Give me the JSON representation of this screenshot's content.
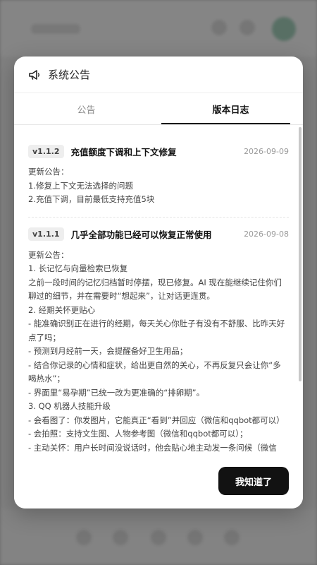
{
  "modal": {
    "title": "系统公告",
    "icon": "megaphone-icon"
  },
  "tabs": [
    {
      "label": "公告",
      "active": false
    },
    {
      "label": "版本日志",
      "active": true
    }
  ],
  "entries": [
    {
      "version": "v1.1.2",
      "title": "充值额度下调和上下文修复",
      "date": "2026-09-09",
      "lines": [
        "更新公告：",
        "1.修复上下文无法选择的问题",
        "2.充值下调，目前最低支持充值5块"
      ]
    },
    {
      "version": "v1.1.1",
      "title": "几乎全部功能已经可以恢复正常使用",
      "date": "2026-09-08",
      "lines": [
        "更新公告：",
        "1. 长记忆与向量检索已恢复",
        "之前一段时间的记忆归档暂时停摆，现已修复。AI 现在能继续记住你们聊过的细节，并在需要时“想起来”，让对话更连贯。",
        "2. 经期关怀更贴心",
        "- 能准确识别正在进行的经期，每天关心你肚子有没有不舒服、比昨天好点了吗；",
        "- 预测到月经前一天，会提醒备好卫生用品；",
        "- 结合你记录的心情和症状，给出更自然的关心，不再反复只会让你“多喝热水”；",
        "- 界面里“易孕期”已统一改为更准确的“排卵期”。",
        "3. QQ 机器人技能升级",
        "- 会看图了：你发图片，它能真正“看到”并回应（微信和qqbot都可以）",
        "- 会拍照：支持文生图、人物参考图（微信和qqbot都可以）；",
        "- 主动关怀：用户长时间没说话时，他会贴心地主动发一条问候（微信"
      ]
    }
  ],
  "footer": {
    "ok_label": "我知道了"
  },
  "colors": {
    "primary_button": "#121212",
    "badge_bg": "#eeeeee",
    "overlay": "#5a5a5a"
  }
}
